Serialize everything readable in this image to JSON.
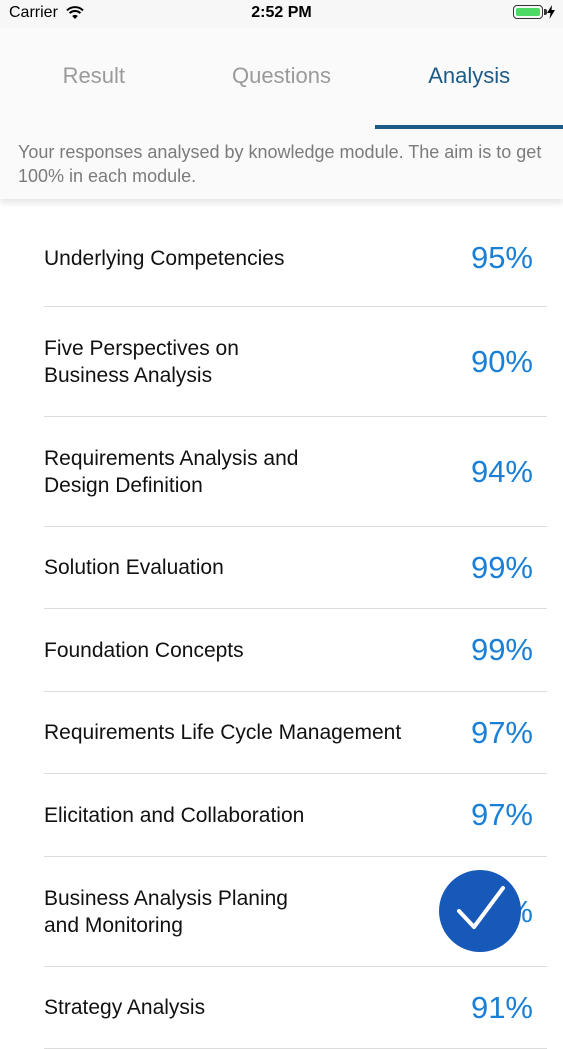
{
  "status_bar": {
    "carrier": "Carrier",
    "time": "2:52 PM"
  },
  "tabs": [
    {
      "label": "Result",
      "active": false
    },
    {
      "label": "Questions",
      "active": false
    },
    {
      "label": "Analysis",
      "active": true
    }
  ],
  "description": "Your responses analysed by knowledge module. The aim is to get 100% in each module.",
  "modules": [
    {
      "name": "Underlying Competencies",
      "score": "95%"
    },
    {
      "name": "Five Perspectives on Business Analysis",
      "score": "90%"
    },
    {
      "name": "Requirements Analysis and Design Definition",
      "score": "94%"
    },
    {
      "name": "Solution Evaluation",
      "score": "99%"
    },
    {
      "name": "Foundation Concepts",
      "score": "99%"
    },
    {
      "name": "Requirements Life Cycle Management",
      "score": "97%"
    },
    {
      "name": "Elicitation and Collaboration",
      "score": "97%"
    },
    {
      "name": "Business Analysis Planing and Monitoring",
      "score": "%"
    },
    {
      "name": "Strategy Analysis",
      "score": "91%"
    }
  ],
  "colors": {
    "accent": "#1e5a86",
    "score": "#1a7fd6",
    "fab": "#1759b8"
  },
  "icons": {
    "fab": "checkmark-icon"
  }
}
